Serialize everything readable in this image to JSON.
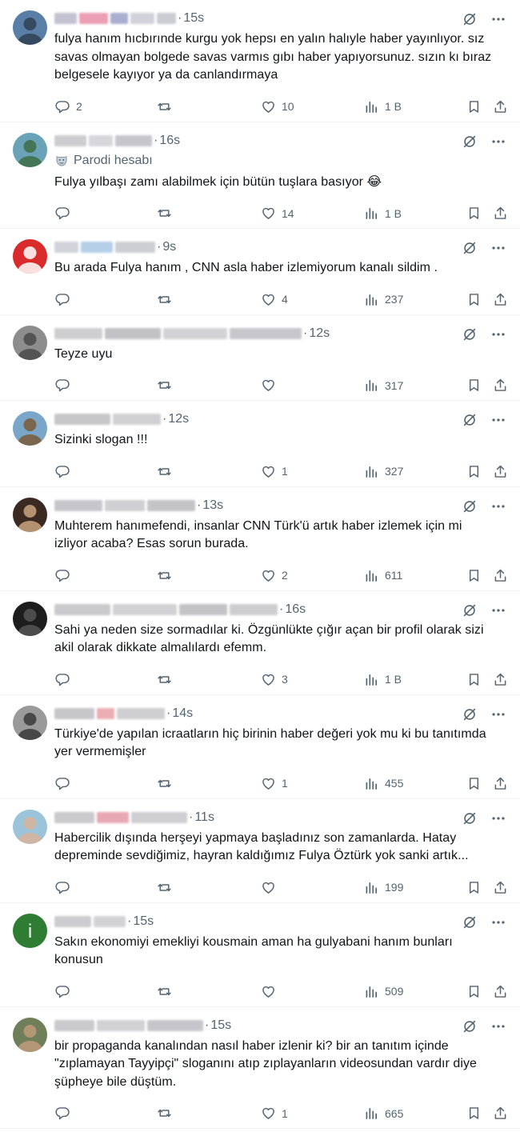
{
  "tweets": [
    {
      "name_colors": [
        "#b8b8c8",
        "#e88ea8",
        "#9aa0c8",
        "#c9c9d3",
        "#c0c4cc"
      ],
      "avatar": {
        "bg": "#5a7fa6",
        "fg": "#2f3f52"
      },
      "time": "15s",
      "text": "fulya hanım hıcbırınde kurgu yok hepsı en yalın halıyle haber yayınlıyor. sız\nsavas olmayan bolgede savas varmıs gıbı haber yapıyorsunuz. sızın kı bıraz\nbelgesele kayıyor ya da canlandırmaya",
      "replies": "2",
      "retweets": "",
      "likes": "10",
      "views": "1 B"
    },
    {
      "name_colors": [
        "#c2c2c8",
        "#cfcfd6",
        "#bcbcc4"
      ],
      "avatar": {
        "bg": "#6aa2b8",
        "fg": "#3c6f45"
      },
      "time": "16s",
      "parody": "Parodi hesabı",
      "text": "Fulya yılbaşı zamı alabilmek için bütün tuşlara basıyor 😂",
      "replies": "",
      "retweets": "",
      "likes": "14",
      "views": "1 B"
    },
    {
      "name_colors": [
        "#c8ccd3",
        "#a9c7e6",
        "#c4c6cc"
      ],
      "avatar": {
        "bg": "#d92b2b",
        "fg": "#ffffff"
      },
      "time": "9s",
      "text": "Bu arada Fulya hanım , CNN asla haber izlemiyorum kanalı sildim .",
      "replies": "",
      "retweets": "",
      "likes": "4",
      "views": "237"
    },
    {
      "name_colors": [
        "#c6c6ca",
        "#b7b7bd",
        "#cbcbd0",
        "#bdbdc4"
      ],
      "avatar": {
        "bg": "#8d8d8d",
        "fg": "#4a4a4a"
      },
      "time": "12s",
      "text": "Teyze uyu",
      "replies": "",
      "retweets": "",
      "likes": "",
      "views": "317"
    },
    {
      "name_colors": [
        "#bdbdc3",
        "#c9c9ce"
      ],
      "avatar": {
        "bg": "#7aa7c9",
        "fg": "#7a5a3a"
      },
      "time": "12s",
      "text": "Sizinki slogan !!!",
      "replies": "",
      "retweets": "",
      "likes": "1",
      "views": "327"
    },
    {
      "name_colors": [
        "#bcbcc2",
        "#c7c7cc",
        "#b9b9bf"
      ],
      "avatar": {
        "bg": "#3b2a22",
        "fg": "#c9a37f"
      },
      "time": "13s",
      "text": "Muhterem hanımefendi, insanlar CNN Türk'ü artık haber izlemek için mi\nizliyor acaba? Esas sorun burada.",
      "replies": "",
      "retweets": "",
      "likes": "2",
      "views": "611"
    },
    {
      "name_colors": [
        "#c0c0c6",
        "#cacacf",
        "#b8b8be",
        "#c4c4ca"
      ],
      "avatar": {
        "bg": "#1d1d1d",
        "fg": "#555555"
      },
      "time": "16s",
      "text": "Sahi ya neden size sormadılar ki. Özgünlükte çığır açan bir profil olarak sizi\nakil olarak dikkate almalılardı efemm.",
      "replies": "",
      "retweets": "",
      "likes": "3",
      "views": "1 B"
    },
    {
      "name_colors": [
        "#bdbdc3",
        "#e8a0a8",
        "#c7c7cc"
      ],
      "avatar": {
        "bg": "#9a9a9a",
        "fg": "#3a3a3a"
      },
      "time": "14s",
      "text": "Türkiye'de yapılan icraatların hiç birinin haber değeri yok mu ki bu tanıtımda\nyer vermemişler",
      "replies": "",
      "retweets": "",
      "likes": "1",
      "views": "455"
    },
    {
      "name_colors": [
        "#c0c0c6",
        "#e49aa6",
        "#c6c6cc"
      ],
      "avatar": {
        "bg": "#9bc3d9",
        "fg": "#d8b49a"
      },
      "time": "11s",
      "text": "Habercilik dışında herşeyi yapmaya başladınız son zamanlarda. Hatay\ndepreminde sevdiğimiz, hayran kaldığımız Fulya Öztürk yok sanki artık...",
      "replies": "",
      "retweets": "",
      "likes": "",
      "views": "199"
    },
    {
      "name_colors": [
        "#c3c3c8",
        "#cbcbd0"
      ],
      "avatar": {
        "bg": "#2e7d32",
        "fg": "#ffffff",
        "letter": "i"
      },
      "time": "15s",
      "text": "Sakın ekonomiyi emekliyi kousmain aman ha gulyabani hanım  bunları\nkonusun",
      "replies": "",
      "retweets": "",
      "likes": "",
      "views": "509"
    },
    {
      "name_colors": [
        "#c0c0c6",
        "#c9c9ce",
        "#bcbcc2"
      ],
      "avatar": {
        "bg": "#6f7f5a",
        "fg": "#c09a7a"
      },
      "time": "15s",
      "text": "bir propaganda kanalından nasıl haber izlenir ki? bir an tanıtım içinde\n\"zıplamayan Tayyipçi\" sloganını atıp zıplayanların videosundan vardır diye\nşüpheye bile düştüm.",
      "replies": "",
      "retweets": "",
      "likes": "1",
      "views": "665"
    }
  ]
}
